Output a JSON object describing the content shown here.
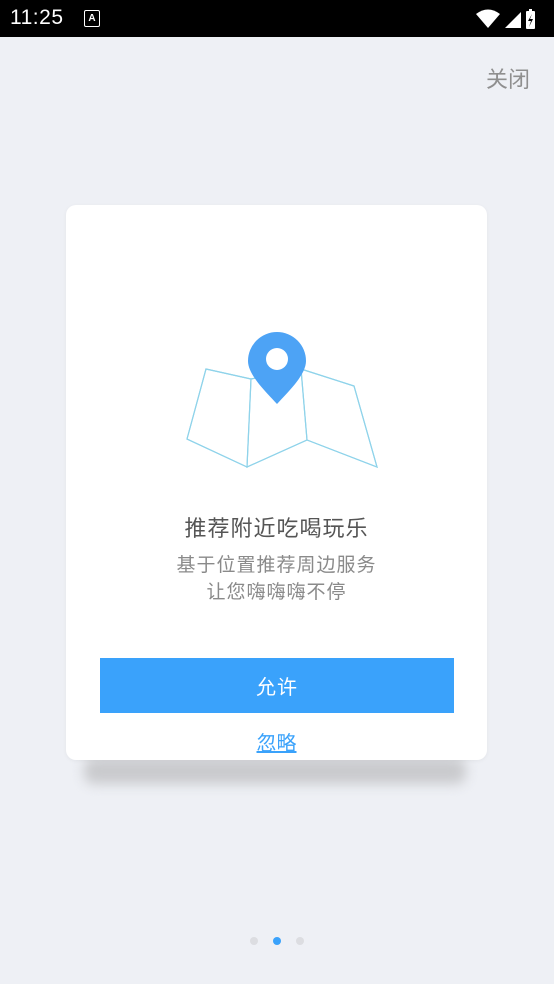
{
  "status_bar": {
    "time": "11:25",
    "notification_icon": "A"
  },
  "header": {
    "close_label": "关闭"
  },
  "card": {
    "title": "推荐附近吃喝玩乐",
    "desc_line1": "基于位置推荐周边服务",
    "desc_line2": "让您嗨嗨嗨不停",
    "allow_label": "允许",
    "ignore_label": "忽略",
    "illustration_icon": "map-pin-icon"
  },
  "pager": {
    "total": 3,
    "active_index": 1
  },
  "colors": {
    "accent": "#3aa2fb",
    "background": "#eef0f5",
    "title_text": "#555555",
    "muted_text": "#8a8a8a",
    "map_stroke": "#8fd3ea"
  }
}
